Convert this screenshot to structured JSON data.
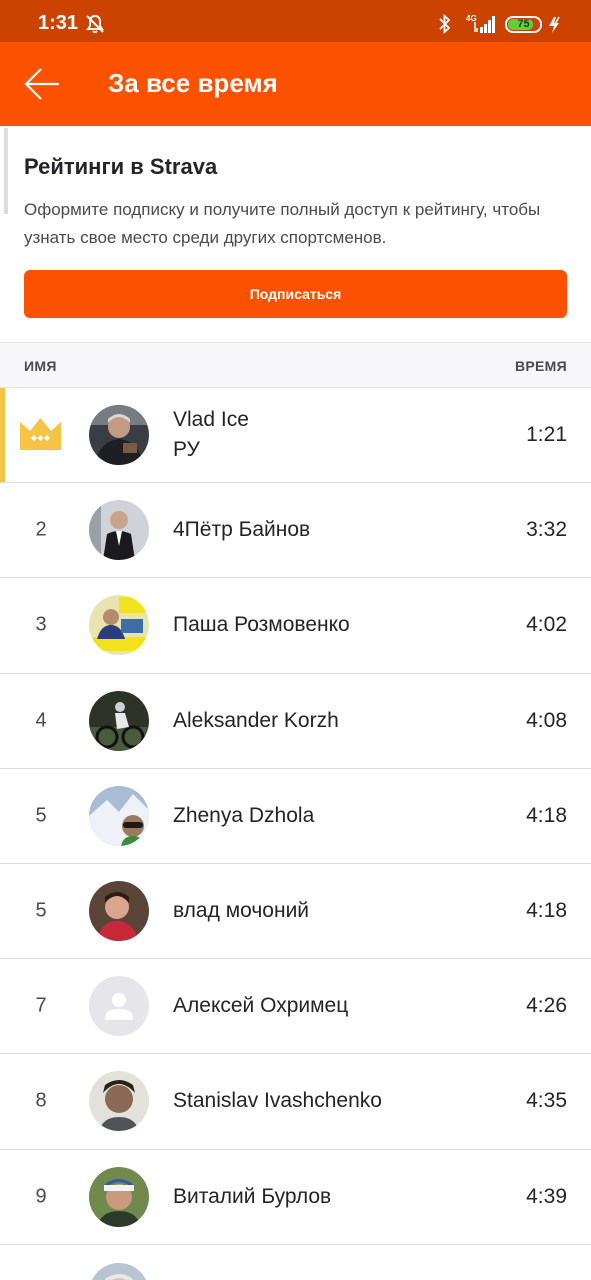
{
  "status_bar": {
    "time": "1:31",
    "network": "4G",
    "battery": "75",
    "battery_level": 0.75
  },
  "app_bar": {
    "title": "За все время",
    "back_icon": "arrow-left-icon"
  },
  "promo": {
    "title": "Рейтинги в Strava",
    "text": "Оформите подписку и получите полный доступ к рейтингу, чтобы узнать свое место среди других спортсменов.",
    "button": "Подписаться"
  },
  "table": {
    "col_name": "ИМЯ",
    "col_time": "ВРЕМЯ"
  },
  "leaderboard": [
    {
      "rank": "",
      "rank_icon": "crown-icon",
      "name": "Vlad Ice",
      "sub": "РУ",
      "time": "1:21"
    },
    {
      "rank": "2",
      "name": "4Пётр Байнов",
      "time": "3:32"
    },
    {
      "rank": "3",
      "name": "Паша Розмовенко",
      "time": "4:02"
    },
    {
      "rank": "4",
      "name": "Aleksander Korzh",
      "time": "4:08"
    },
    {
      "rank": "5",
      "name": "Zhenya Dzhola",
      "time": "4:18"
    },
    {
      "rank": "5",
      "name": "влад мочоний",
      "time": "4:18"
    },
    {
      "rank": "7",
      "name": "Алексей Охримец",
      "time": "4:26"
    },
    {
      "rank": "8",
      "name": "Stanislav Ivashchenko",
      "time": "4:35"
    },
    {
      "rank": "9",
      "name": "Виталий Бурлов",
      "time": "4:39"
    }
  ],
  "colors": {
    "brand": "#fc5200",
    "status_bar": "#cc4200",
    "crown": "#f6c444"
  }
}
